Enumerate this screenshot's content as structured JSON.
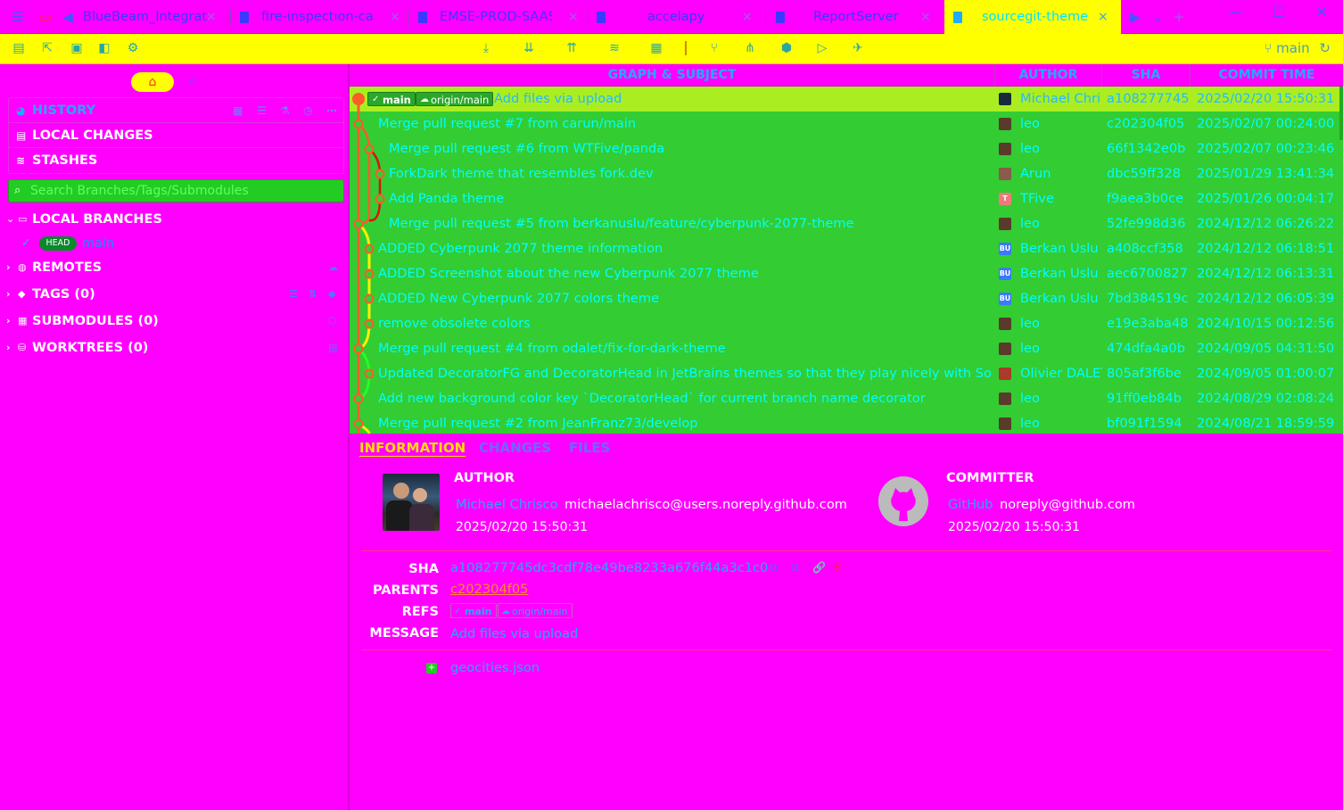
{
  "tabs": [
    {
      "label": "BlueBeam_Integrat",
      "close": "×"
    },
    {
      "label": "fire-inspection-calc",
      "close": "×"
    },
    {
      "label": "EMSE-PROD-SAAS",
      "close": "×"
    },
    {
      "label": "accelapy",
      "close": "×"
    },
    {
      "label": "ReportServer",
      "close": "×"
    },
    {
      "label": "sourcegit-theme",
      "close": "×"
    }
  ],
  "window": {
    "minimize": "—",
    "maximize": "☐",
    "close": "✕",
    "add_tab": "+"
  },
  "toolbar": {
    "current_branch": "main"
  },
  "sidebar": {
    "nav": [
      {
        "label": "HISTORY",
        "icon": "history-icon"
      },
      {
        "label": "LOCAL CHANGES",
        "icon": "local-changes-icon"
      },
      {
        "label": "STASHES",
        "icon": "stashes-icon"
      }
    ],
    "search_placeholder": "Search Branches/Tags/Submodules",
    "sections": {
      "local_branches": "LOCAL BRANCHES",
      "remotes": "REMOTES",
      "tags": "TAGS (0)",
      "submodules": "SUBMODULES (0)",
      "worktrees": "WORKTREES (0)"
    },
    "head_badge": "HEAD",
    "branch_name": "main"
  },
  "columns": {
    "graph_subject": "GRAPH & SUBJECT",
    "author": "AUTHOR",
    "sha": "SHA",
    "commit_time": "COMMIT TIME"
  },
  "commits": [
    {
      "subject": "Add files via upload",
      "author": "Michael Chri",
      "sha": "a108277745",
      "time": "2025/02/20 15:50:31",
      "avatar_color": "#1a2a3a",
      "avatar_text": ""
    },
    {
      "subject": "Merge pull request #7 from carun/main",
      "author": "leo",
      "sha": "c202304f05",
      "time": "2025/02/07 00:24:00",
      "avatar_color": "#5a3a2a",
      "avatar_text": ""
    },
    {
      "subject": "Merge pull request #6 from WTFive/panda",
      "author": "leo",
      "sha": "66f1342e0b",
      "time": "2025/02/07 00:23:46",
      "avatar_color": "#5a3a2a",
      "avatar_text": ""
    },
    {
      "subject": "ForkDark theme that resembles fork.dev",
      "author": "Arun",
      "sha": "dbc59ff328",
      "time": "2025/01/29 13:41:34",
      "avatar_color": "#8a5a4a",
      "avatar_text": ""
    },
    {
      "subject": "Add Panda theme",
      "author": "TFive",
      "sha": "f9aea3b0ce",
      "time": "2025/01/26 00:04:17",
      "avatar_color": "#ee7a7a",
      "avatar_text": "T"
    },
    {
      "subject": "Merge pull request #5 from berkanuslu/feature/cyberpunk-2077-theme",
      "author": "leo",
      "sha": "52fe998d36",
      "time": "2024/12/12 06:26:22",
      "avatar_color": "#5a3a2a",
      "avatar_text": ""
    },
    {
      "subject": "ADDED Cyberpunk 2077 theme information",
      "author": "Berkan Uslu",
      "sha": "a408ccf358",
      "time": "2024/12/12 06:18:51",
      "avatar_color": "#3a7aff",
      "avatar_text": "BU"
    },
    {
      "subject": "ADDED Screenshot about the new Cyberpunk 2077 theme",
      "author": "Berkan Uslu",
      "sha": "aec6700827",
      "time": "2024/12/12 06:13:31",
      "avatar_color": "#3a7aff",
      "avatar_text": "BU"
    },
    {
      "subject": "ADDED New Cyberpunk 2077 colors theme",
      "author": "Berkan Uslu",
      "sha": "7bd384519c",
      "time": "2024/12/12 06:05:39",
      "avatar_color": "#3a7aff",
      "avatar_text": "BU"
    },
    {
      "subject": "remove obsolete colors",
      "author": "leo",
      "sha": "e19e3aba48",
      "time": "2024/10/15 00:12:56",
      "avatar_color": "#5a3a2a",
      "avatar_text": ""
    },
    {
      "subject": "Merge pull request #4 from odalet/fix-for-dark-theme",
      "author": "leo",
      "sha": "474dfa4a0b",
      "time": "2024/09/05 04:31:50",
      "avatar_color": "#5a3a2a",
      "avatar_text": ""
    },
    {
      "subject": "Updated DecoratorFG and DecoratorHead in JetBrains themes so that they play nicely with Sourc",
      "author": "Olivier DALET",
      "sha": "805af3f6be",
      "time": "2024/09/05 01:00:07",
      "avatar_color": "#aa3a2a",
      "avatar_text": ""
    },
    {
      "subject": "Add new background color key `DecoratorHead` for current branch name decorator",
      "author": "leo",
      "sha": "91ff0eb84b",
      "time": "2024/08/29 02:08:24",
      "avatar_color": "#5a3a2a",
      "avatar_text": ""
    },
    {
      "subject": "Merge pull request #2 from JeanFranz73/develop",
      "author": "leo",
      "sha": "bf091f1594",
      "time": "2024/08/21 18:59:59",
      "avatar_color": "#5a3a2a",
      "avatar_text": ""
    }
  ],
  "refs": {
    "local": "main",
    "remote": "origin/main"
  },
  "detail": {
    "tabs": [
      "INFORMATION",
      "CHANGES",
      "FILES"
    ],
    "author_heading": "AUTHOR",
    "author_name": "Michael Chrisco",
    "author_email": "michaelachrisco@users.noreply.github.com",
    "author_time": "2025/02/20 15:50:31",
    "committer_heading": "COMMITTER",
    "committer_name": "GitHub",
    "committer_email": "noreply@github.com",
    "committer_time": "2025/02/20 15:50:31",
    "sha_label": "SHA",
    "sha": "a108277745dc3cdf78e49be8233a676f44a3c1c0",
    "parents_label": "PARENTS",
    "parent": "c202304f05",
    "refs_label": "REFS",
    "ref_local": "main",
    "ref_remote": "origin/main",
    "message_label": "MESSAGE",
    "message": "Add files via upload",
    "file": "geocities.json"
  },
  "colors": {
    "accent": "#22aaff",
    "selected_row": "#aaee22",
    "list_bg": "#33cc33",
    "toolbar_bg": "#ffff00",
    "page_bg": "#ff00ff"
  }
}
